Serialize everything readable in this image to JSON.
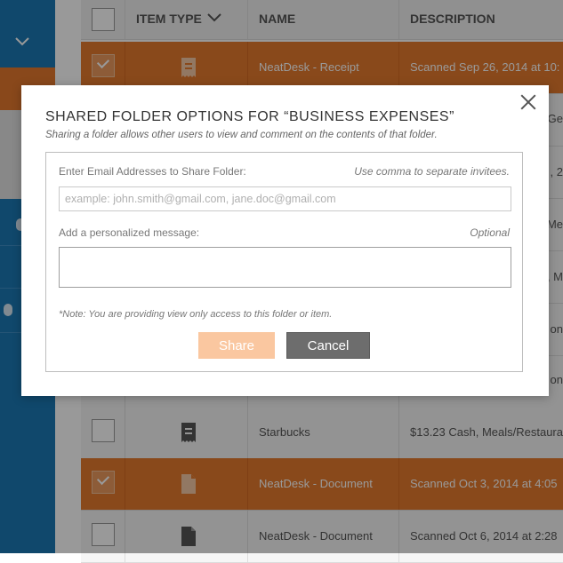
{
  "table": {
    "headers": {
      "item_type": "ITEM TYPE",
      "name": "NAME",
      "description": "DESCRIPTION"
    },
    "rows": [
      {
        "name": "NeatDesk - Receipt",
        "description": "Scanned Sep 26, 2014 at 10:",
        "checked": true,
        "icon": "receipt-icon"
      },
      {
        "name": "Starbucks",
        "description": "$13.23 Cash, Meals/Restaura",
        "checked": false,
        "icon": "receipt-icon"
      },
      {
        "name": "NeatDesk - Document",
        "description": "Scanned Oct 3, 2014 at 4:05",
        "checked": true,
        "icon": "document-icon"
      },
      {
        "name": "NeatDesk - Document",
        "description": "Scanned Oct 6, 2014 at 2:28",
        "checked": false,
        "icon": "document-icon"
      }
    ],
    "edge_fragments": [
      "Ge",
      ", 2",
      "Me",
      ", M",
      "on",
      "on"
    ]
  },
  "modal": {
    "title": "SHARED FOLDER OPTIONS FOR “BUSINESS EXPENSES”",
    "subtitle": "Sharing a folder allows other users to view and comment on the contents of that folder.",
    "email_label": "Enter Email Addresses to Share Folder:",
    "email_hint": "Use comma to separate invitees.",
    "email_placeholder": "example: john.smith@gmail.com, jane.doc@gmail.com",
    "email_value": "",
    "message_label": "Add a personalized message:",
    "message_hint": "Optional",
    "message_value": "",
    "note": "*Note: You are providing view only access to this folder or item.",
    "share_label": "Share",
    "cancel_label": "Cancel"
  },
  "colors": {
    "sidebar": "#1b78b4",
    "accent_orange": "#e57b2e",
    "share_disabled": "#fac7a0",
    "cancel_gray": "#6d6d6d"
  }
}
